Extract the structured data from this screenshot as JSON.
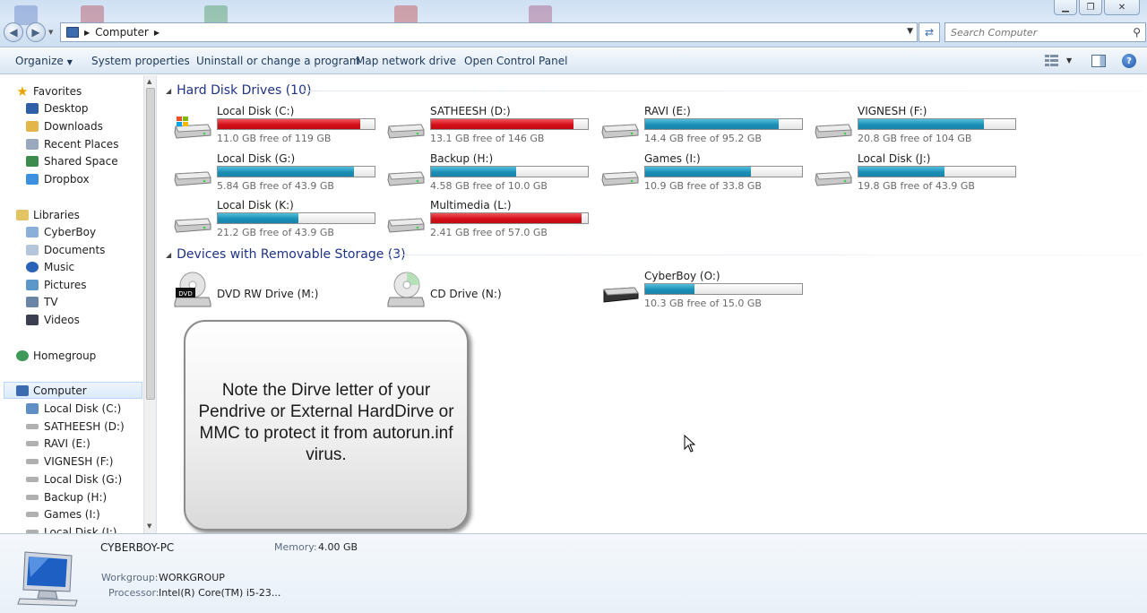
{
  "address_bar": {
    "path": [
      "Computer"
    ]
  },
  "search": {
    "placeholder": "Search Computer"
  },
  "command_bar": {
    "organize": "Organize",
    "system_properties": "System properties",
    "uninstall": "Uninstall or change a program",
    "map_drive": "Map network drive",
    "control_panel": "Open Control Panel"
  },
  "nav": {
    "favorites": {
      "label": "Favorites",
      "items": [
        "Desktop",
        "Downloads",
        "Recent Places",
        "Shared Space",
        "Dropbox"
      ]
    },
    "libraries": {
      "label": "Libraries",
      "items": [
        "CyberBoy",
        "Documents",
        "Music",
        "Pictures",
        "TV",
        "Videos"
      ]
    },
    "homegroup": "Homegroup",
    "computer": {
      "label": "Computer",
      "items": [
        "Local Disk (C:)",
        "SATHEESH (D:)",
        "RAVI (E:)",
        "VIGNESH (F:)",
        "Local Disk (G:)",
        "Backup (H:)",
        "Games (I:)",
        "Local Disk (J:)"
      ]
    }
  },
  "hard_disks": {
    "header": "Hard Disk Drives (10)",
    "drives": [
      {
        "name": "Local Disk (C:)",
        "free": "11.0 GB free of 119 GB",
        "used_fraction": 0.908,
        "status": "red"
      },
      {
        "name": "SATHEESH (D:)",
        "free": "13.1 GB free of 146 GB",
        "used_fraction": 0.91,
        "status": "red"
      },
      {
        "name": "RAVI (E:)",
        "free": "14.4 GB free of 95.2 GB",
        "used_fraction": 0.849,
        "status": "blue"
      },
      {
        "name": "VIGNESH (F:)",
        "free": "20.8 GB free of 104 GB",
        "used_fraction": 0.8,
        "status": "blue"
      },
      {
        "name": "Local Disk (G:)",
        "free": "5.84 GB free of 43.9 GB",
        "used_fraction": 0.867,
        "status": "blue"
      },
      {
        "name": "Backup (H:)",
        "free": "4.58 GB free of 10.0 GB",
        "used_fraction": 0.542,
        "status": "blue"
      },
      {
        "name": "Games (I:)",
        "free": "10.9 GB free of 33.8 GB",
        "used_fraction": 0.677,
        "status": "blue"
      },
      {
        "name": "Local Disk (J:)",
        "free": "19.8 GB free of 43.9 GB",
        "used_fraction": 0.549,
        "status": "blue"
      },
      {
        "name": "Local Disk (K:)",
        "free": "21.2 GB free of 43.9 GB",
        "used_fraction": 0.517,
        "status": "blue"
      },
      {
        "name": "Multimedia (L:)",
        "free": "2.41 GB free of 57.0 GB",
        "used_fraction": 0.958,
        "status": "red"
      }
    ]
  },
  "removable": {
    "header": "Devices with Removable Storage (3)",
    "drives": [
      {
        "name": "DVD RW Drive (M:)",
        "icon": "dvd"
      },
      {
        "name": "CD Drive (N:)",
        "icon": "cd"
      },
      {
        "name": "CyberBoy (O:)",
        "free": "10.3 GB free of 15.0 GB",
        "used_fraction": 0.313,
        "status": "blue",
        "icon": "usb"
      }
    ],
    "dvd_badge": "DVD"
  },
  "callout": {
    "text": "Note the Dirve letter of your Pendrive or External HardDirve or MMC to protect it from autorun.inf virus."
  },
  "details": {
    "pc_name": "CYBERBOY-PC",
    "memory_label": "Memory:",
    "memory_value": "4.00 GB",
    "workgroup_label": "Workgroup:",
    "workgroup_value": "WORKGROUP",
    "processor_label": "Processor:",
    "processor_value": "Intel(R) Core(TM) i5-23..."
  },
  "colors": {
    "bar_blue": "#26a0da",
    "bar_red": "#da2626",
    "header_blue": "#1e3287"
  }
}
